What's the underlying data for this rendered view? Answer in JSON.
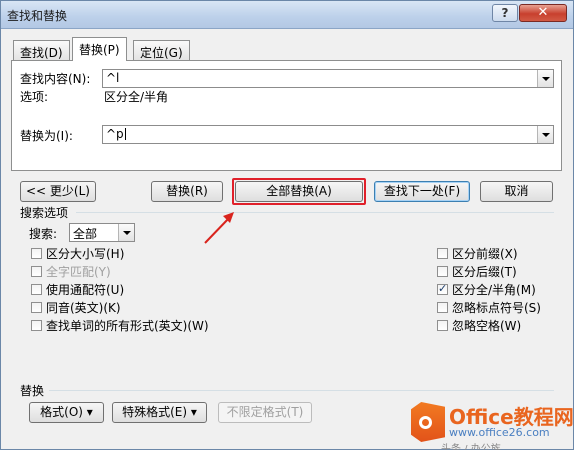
{
  "window": {
    "title": "查找和替换",
    "help": "?",
    "close": "✕"
  },
  "tabs": [
    {
      "label": "查找(D)",
      "active": false
    },
    {
      "label": "替换(P)",
      "active": true
    },
    {
      "label": "定位(G)",
      "active": false
    }
  ],
  "find": {
    "label": "查找内容(N):",
    "value": "^l",
    "options_label": "选项:",
    "options_value": "区分全/半角"
  },
  "replace": {
    "label": "替换为(I):",
    "value": "^p"
  },
  "buttons": {
    "less": "<< 更少(L)",
    "replace": "替换(R)",
    "replace_all": "全部替换(A)",
    "find_next": "查找下一处(F)",
    "cancel": "取消"
  },
  "search_options": {
    "title": "搜索选项",
    "search_label": "搜索:",
    "search_value": "全部",
    "left": [
      {
        "label": "区分大小写(H)",
        "checked": false,
        "disabled": false
      },
      {
        "label": "全字匹配(Y)",
        "checked": false,
        "disabled": true
      },
      {
        "label": "使用通配符(U)",
        "checked": false,
        "disabled": false
      },
      {
        "label": "同音(英文)(K)",
        "checked": false,
        "disabled": false
      },
      {
        "label": "查找单词的所有形式(英文)(W)",
        "checked": false,
        "disabled": false
      }
    ],
    "right": [
      {
        "label": "区分前缀(X)",
        "checked": false,
        "disabled": false
      },
      {
        "label": "区分后缀(T)",
        "checked": false,
        "disabled": false
      },
      {
        "label": "区分全/半角(M)",
        "checked": true,
        "disabled": false
      },
      {
        "label": "忽略标点符号(S)",
        "checked": false,
        "disabled": false
      },
      {
        "label": "忽略空格(W)",
        "checked": false,
        "disabled": false
      }
    ]
  },
  "replace_section": {
    "title": "替换",
    "format": "格式(O) ▾",
    "special": "特殊格式(E) ▾",
    "no_format": "不限定格式(T)"
  },
  "watermark": {
    "brand": "Office教程网",
    "url": "www.office26.com",
    "footer": "头条 / 办公族"
  },
  "colors": {
    "highlight": "#e0202a",
    "arrow": "#d9241d",
    "brand_orange": "#e9651f"
  }
}
